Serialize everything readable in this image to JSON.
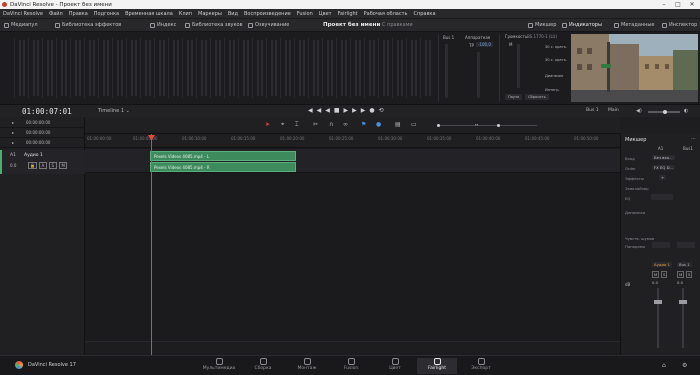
{
  "window": {
    "title": "DaVinci Resolve - Проект без имени"
  },
  "menu": [
    "DaVinci Resolve",
    "Файл",
    "Правка",
    "Подгонка",
    "Временная шкала",
    "Клип",
    "Маркеры",
    "Вид",
    "Воспроизведение",
    "Fusion",
    "Цвет",
    "Fairlight",
    "Рабочая область",
    "Справка"
  ],
  "toolbar": {
    "media": "Медиапул",
    "effects": "Библиотека эффектов",
    "index": "Индекс",
    "sound_library": "Библиотека звуков",
    "dubbing": "Озвучивание",
    "project_title": "Проект без имени",
    "project_status": "С правками",
    "mixer": "Микшер",
    "meters": "Индикаторы",
    "metadata": "Метаданные",
    "inspector": "Инспектор"
  },
  "meters_panel": {
    "bus_label": "Bus 1",
    "control_room": "Аппаратная",
    "tp_label": "TP",
    "tp_value": "-100,0",
    "loudness_label": "Громкость",
    "loudness_std": "BS.1770-1 (LU)",
    "m_label": "M",
    "short_label": "30 с. кратк.",
    "short2_label": "30 с. кратк.",
    "range_label": "Диапазон",
    "integrated_label": "Интегр.",
    "pause_btn": "Пауза",
    "reset_btn": "Сбросить"
  },
  "transport": {
    "timecode": "01:00:07:01",
    "timeline_name": "Timeline 1",
    "bus_select": "Bus 1",
    "main_select": "Main"
  },
  "tracks_timecodes": [
    "00:00:00:00",
    "00:00:00:00",
    "00:00:00:00"
  ],
  "track": {
    "id": "A1",
    "name": "Аудио 1",
    "level": "0.0",
    "buttons": [
      "A",
      "S",
      "M"
    ]
  },
  "ruler_labels": [
    "01:00:00:00",
    "01:00:05:00",
    "01:00:10:00",
    "01:00:15:00",
    "01:00:20:00",
    "01:00:25:00",
    "01:00:30:00",
    "01:00:35:00",
    "01:00:40:00",
    "01:00:45:00",
    "01:00:50:00"
  ],
  "clips": [
    {
      "label": "Pexels Videos 4085.mp4 - L"
    },
    {
      "label": "Pexels Videos 4085.mp4 - R"
    }
  ],
  "inspector": {
    "title": "Микшер",
    "col_a1": "A1",
    "col_bus": "Bus1",
    "rows": [
      {
        "label": "Вход",
        "a1": "Без вхо..."
      },
      {
        "label": "Order",
        "a1": "FX EQ D..."
      },
      {
        "label": "Эффекты",
        "a1": "+"
      },
      {
        "label": "Эквалайзер",
        "a1": ""
      },
      {
        "label": "EQ",
        "a1": ""
      },
      {
        "label": "Динамика",
        "a1": ""
      },
      {
        "label": "Чувств. шумов",
        "a1": ""
      },
      {
        "label": "Панорама",
        "a1": ""
      }
    ],
    "track_name": "Аудио 1",
    "bus_name": "Bus 1",
    "db_label": "dB",
    "fader_a1": "0.0",
    "fader_bus": "0.0",
    "ms_a1": [
      "M",
      "S"
    ],
    "ms_bus": [
      "M",
      "S"
    ]
  },
  "pages": [
    "Мультимедиа",
    "Сборка",
    "Монтаж",
    "Fusion",
    "Цвет",
    "Fairlight",
    "Экспорт"
  ],
  "active_page": "Fairlight",
  "app_name": "DaVinci Resolve 17"
}
